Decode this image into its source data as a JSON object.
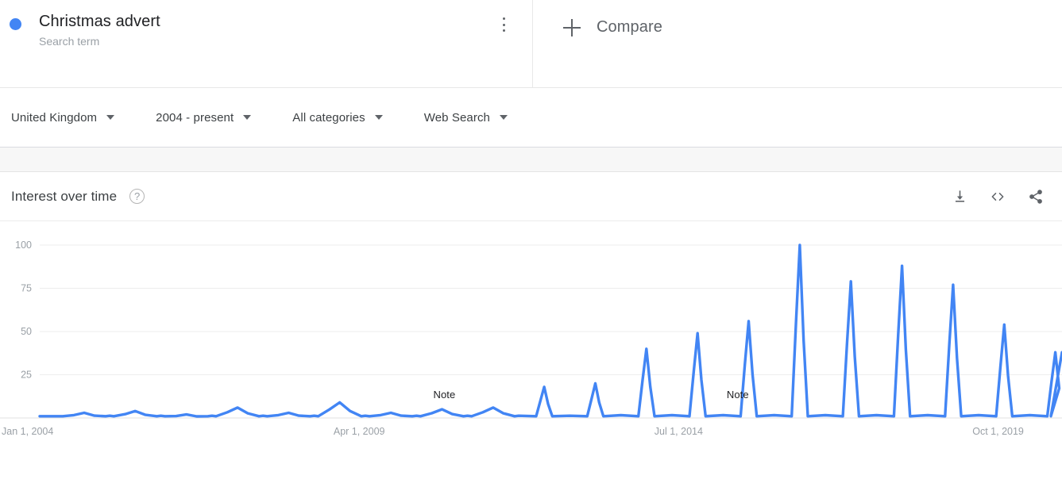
{
  "term": {
    "title": "Christmas advert",
    "subtitle": "Search term",
    "dot_color": "#4285f4",
    "menu_icon": "kebab-menu-icon"
  },
  "compare": {
    "label": "Compare",
    "icon": "plus-icon"
  },
  "filters": [
    {
      "label": "United Kingdom"
    },
    {
      "label": "2004 - present"
    },
    {
      "label": "All categories"
    },
    {
      "label": "Web Search"
    }
  ],
  "chart_card": {
    "title": "Interest over time",
    "help_icon": "help-circle-icon",
    "tools": [
      {
        "name": "download-icon",
        "glyph": "download"
      },
      {
        "name": "embed-icon",
        "glyph": "<>"
      },
      {
        "name": "share-icon",
        "glyph": "share"
      }
    ]
  },
  "chart_data": {
    "type": "line",
    "title": "Interest over time",
    "xlabel": "",
    "ylabel": "",
    "ylim": [
      0,
      100
    ],
    "grid": true,
    "legend": [
      "Christmas advert"
    ],
    "line_color": "#4285f4",
    "xtick_labels": [
      "Jan 1, 2004",
      "Apr 1, 2009",
      "Jul 1, 2014",
      "Oct 1, 2019"
    ],
    "xtick_positions": [
      0,
      0.3125,
      0.625,
      0.9375
    ],
    "ytick_labels": [
      "25",
      "50",
      "75",
      "100"
    ],
    "ytick_values": [
      25,
      50,
      75,
      100
    ],
    "annotations": [
      {
        "text": "Note",
        "x": 0.385,
        "y": 8
      },
      {
        "text": "Note",
        "x": 0.672,
        "y": 8
      }
    ],
    "series": [
      {
        "name": "Christmas advert",
        "peaks": [
          {
            "year": 2004,
            "value": 3
          },
          {
            "year": 2005,
            "value": 4
          },
          {
            "year": 2006,
            "value": 2
          },
          {
            "year": 2007,
            "value": 6
          },
          {
            "year": 2008,
            "value": 3
          },
          {
            "year": 2009,
            "value": 9
          },
          {
            "year": 2010,
            "value": 3
          },
          {
            "year": 2011,
            "value": 5
          },
          {
            "year": 2012,
            "value": 6
          },
          {
            "year": 2013,
            "value": 18
          },
          {
            "year": 2014,
            "value": 20
          },
          {
            "year": 2015,
            "value": 40
          },
          {
            "year": 2016,
            "value": 49
          },
          {
            "year": 2017,
            "value": 56
          },
          {
            "year": 2018,
            "value": 100
          },
          {
            "year": 2019,
            "value": 79
          },
          {
            "year": 2020,
            "value": 88
          },
          {
            "year": 2021,
            "value": 77
          },
          {
            "year": 2022,
            "value": 54
          },
          {
            "year": 2023,
            "value": 38
          }
        ],
        "baseline": 1,
        "max_value": 100,
        "max_year": 2018
      }
    ]
  }
}
